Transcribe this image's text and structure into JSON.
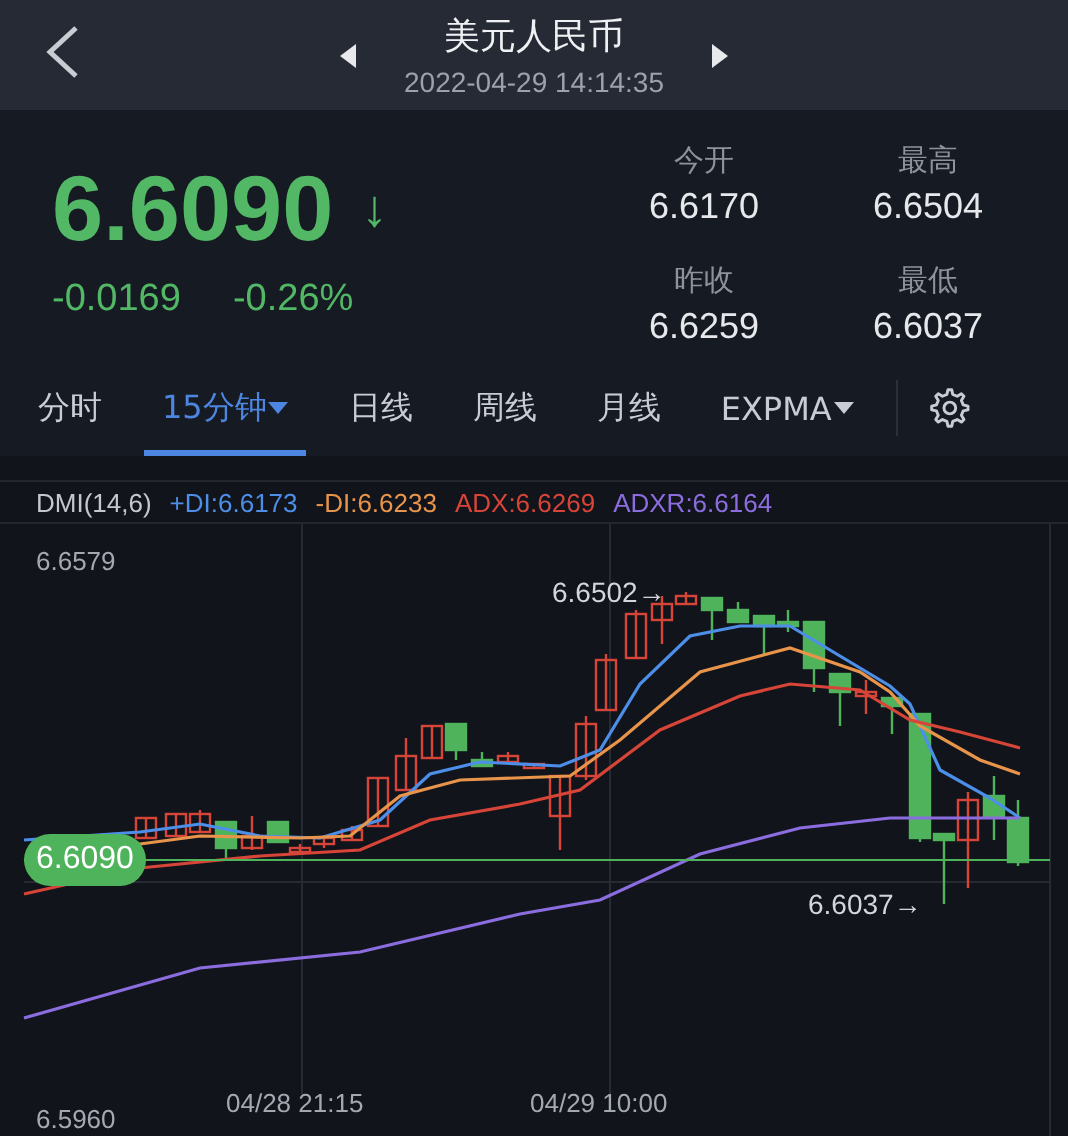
{
  "header": {
    "title": "美元人民币",
    "timestamp": "2022-04-29 14:14:35"
  },
  "quote": {
    "price": "6.6090",
    "direction_arrow": "↓",
    "change": "-0.0169",
    "change_percent": "-0.26%",
    "stats": [
      {
        "label": "今开",
        "value": "6.6170"
      },
      {
        "label": "最高",
        "value": "6.6504"
      },
      {
        "label": "昨收",
        "value": "6.6259"
      },
      {
        "label": "最低",
        "value": "6.6037"
      }
    ]
  },
  "tabs": [
    {
      "label": "分时",
      "selected": false,
      "has_menu": false
    },
    {
      "label": "15分钟",
      "selected": true,
      "has_menu": true
    },
    {
      "label": "日线",
      "selected": false,
      "has_menu": false
    },
    {
      "label": "周线",
      "selected": false,
      "has_menu": false
    },
    {
      "label": "月线",
      "selected": false,
      "has_menu": false
    },
    {
      "label": "EXPMA",
      "selected": false,
      "has_menu": true
    }
  ],
  "legend": [
    {
      "label": "DMI(14,6)",
      "color": "#c4c7ce"
    },
    {
      "label": "+DI:6.6173",
      "color": "#4d8ee8"
    },
    {
      "label": "-DI:6.6233",
      "color": "#e8944a"
    },
    {
      "label": "ADX:6.6269",
      "color": "#d64537"
    },
    {
      "label": "ADXR:6.6164",
      "color": "#8c6de0"
    }
  ],
  "chart": {
    "y_top_label": "6.6579",
    "y_bottom_label": "6.5960",
    "x_labels": [
      "04/28 21:15",
      "04/29 10:00"
    ],
    "high_marker": "6.6502→",
    "low_marker": "6.6037→",
    "current_price": "6.6090"
  }
}
